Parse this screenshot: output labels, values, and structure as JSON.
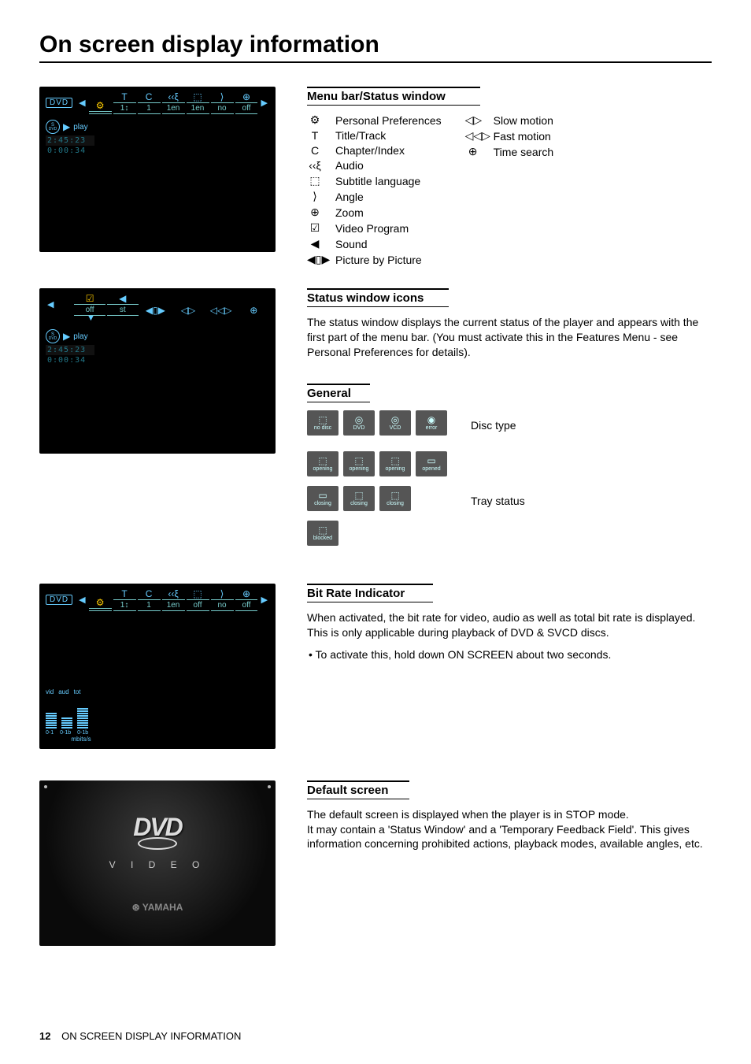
{
  "page_title": "On screen display information",
  "footer": {
    "page_number": "12",
    "section": "ON SCREEN DISPLAY INFORMATION"
  },
  "osd1": {
    "dvd_label": "DVD",
    "menu_icons": [
      "⚙",
      "T",
      "C",
      "‹‹ξ",
      "⬚",
      "⟩",
      "⊕"
    ],
    "menu_values": [
      "",
      "1↕",
      "1",
      "1en",
      "1en",
      "no",
      "off"
    ],
    "status_disc": "S",
    "status_disc_sub": "DVD",
    "status_play_label": "play",
    "time1": "2:45:23",
    "time2": "0:00:34"
  },
  "osd2": {
    "menu_icons": [
      "☑",
      "◀",
      "◀▯▶",
      "◁▷",
      "◁◁▷",
      "⊕"
    ],
    "menu_values": [
      "off",
      "st",
      "",
      "",
      "",
      ""
    ],
    "status_disc": "S",
    "status_disc_sub": "DVD",
    "status_play_label": "play",
    "time1": "2:45:23",
    "time2": "0:00:34"
  },
  "osd3": {
    "dvd_label": "DVD",
    "menu_icons": [
      "⚙",
      "T",
      "C",
      "‹‹ξ",
      "⬚",
      "⟩",
      "⊕"
    ],
    "menu_values": [
      "",
      "1↕",
      "1",
      "1en",
      "off",
      "no",
      "off"
    ],
    "bitrate_labels": [
      "vid",
      "aud",
      "tot"
    ],
    "bitrate_ranges": [
      "0-1",
      "0-1b",
      "0-1b"
    ],
    "bitrate_unit": "mbits/s"
  },
  "default_screen_logo": "DVD",
  "default_screen_video": "V I D E O",
  "default_screen_brand": "⊛ YAMAHA",
  "section1": {
    "heading": "Menu bar/Status window",
    "left_items": [
      {
        "icon": "⚙",
        "label": "Personal Preferences"
      },
      {
        "icon": "T",
        "label": "Title/Track"
      },
      {
        "icon": "C",
        "label": "Chapter/Index"
      },
      {
        "icon": "‹‹ξ",
        "label": "Audio"
      },
      {
        "icon": "⬚",
        "label": "Subtitle language"
      },
      {
        "icon": "⟩",
        "label": "Angle"
      },
      {
        "icon": "⊕",
        "label": "Zoom"
      },
      {
        "icon": "☑",
        "label": "Video Program"
      },
      {
        "icon": "◀",
        "label": "Sound"
      },
      {
        "icon": "◀▯▶",
        "label": "Picture by Picture"
      }
    ],
    "right_items": [
      {
        "icon": "◁▷",
        "label": "Slow motion"
      },
      {
        "icon": "◁◁▷",
        "label": "Fast motion"
      },
      {
        "icon": "⊕",
        "label": "Time search"
      }
    ]
  },
  "section2": {
    "heading": "Status window icons",
    "body": "The status window displays the current status of the player and appears with the first part of the menu bar. (You must activate this in the Features Menu - see Personal Preferences for details)."
  },
  "section3": {
    "heading": "General",
    "disc_type_label": "Disc type",
    "disc_icons": [
      {
        "top": "⬚",
        "bot": "no disc"
      },
      {
        "top": "◎",
        "bot": "DVD"
      },
      {
        "top": "◎",
        "bot": "VCD"
      },
      {
        "top": "◉",
        "bot": "error"
      }
    ],
    "tray_status_label": "Tray status",
    "tray_row1": [
      {
        "top": "⬚",
        "bot": "opening"
      },
      {
        "top": "⬚",
        "bot": "opening"
      },
      {
        "top": "⬚",
        "bot": "opening"
      },
      {
        "top": "▭",
        "bot": "opened"
      }
    ],
    "tray_row2": [
      {
        "top": "▭",
        "bot": "closing"
      },
      {
        "top": "⬚",
        "bot": "closing"
      },
      {
        "top": "⬚",
        "bot": "closing"
      }
    ],
    "tray_row3": [
      {
        "top": "⬚",
        "bot": "blocked"
      }
    ]
  },
  "section4": {
    "heading": "Bit Rate Indicator",
    "body": "When activated, the bit rate for video, audio as well as total bit rate is displayed. This is only applicable during playback of DVD & SVCD discs.",
    "bullet": "• To activate this, hold down ON SCREEN about two seconds."
  },
  "section5": {
    "heading": "Default screen",
    "body": "The default screen is displayed when the player is in STOP mode.\nIt may contain a 'Status Window' and a 'Temporary Feedback Field'. This gives information concerning prohibited actions, playback modes, available angles, etc."
  }
}
